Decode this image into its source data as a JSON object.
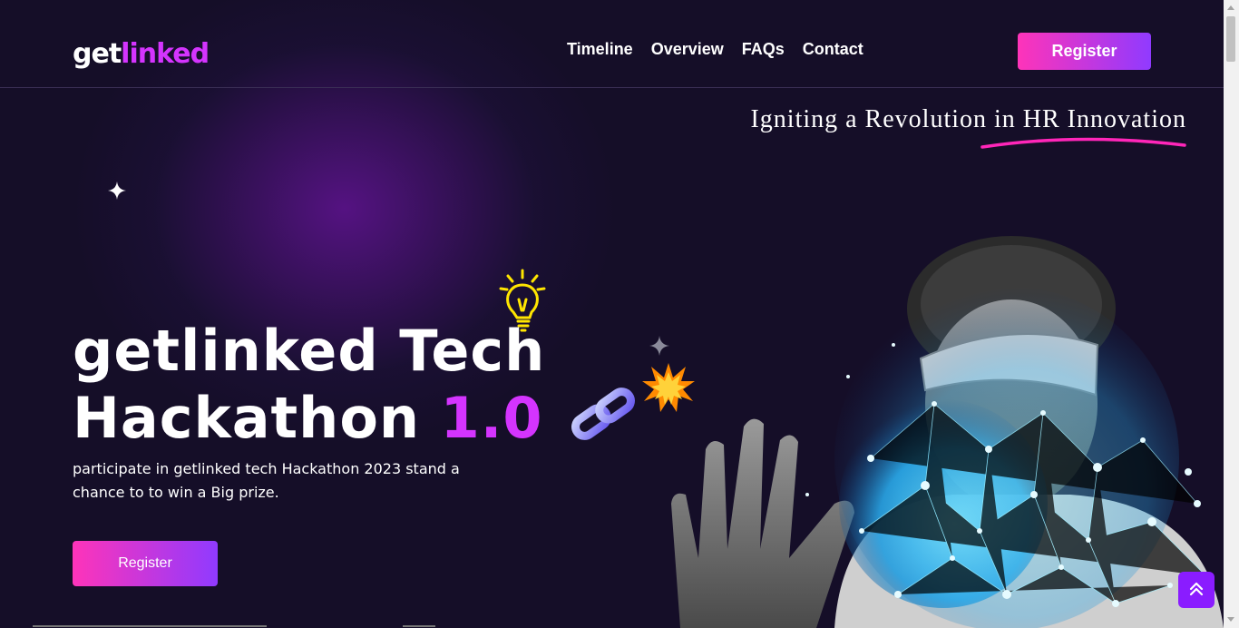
{
  "logo": {
    "part1": "get",
    "part2": "linked"
  },
  "nav": {
    "items": [
      "Timeline",
      "Overview",
      "FAQs",
      "Contact"
    ]
  },
  "header": {
    "register_label": "Register"
  },
  "hero": {
    "tagline": "Igniting a Revolution in HR Innovation",
    "title_line1": "getlinked Tech",
    "title_line2_a": "Hackathon ",
    "title_line2_b": "1.0",
    "description": "participate in getlinked tech Hackathon 2023 stand a chance to to win a Big prize.",
    "register_label": "Register"
  },
  "icons": {
    "scroll_top": "double-chevron-up-icon",
    "bulb": "light-bulb-icon",
    "chain": "chain-link-icon",
    "boom": "explosion-icon",
    "star": "sparkle-star-icon"
  },
  "colors": {
    "background": "#150e28",
    "accent": "#d434fe",
    "gradient_start": "#fe34b9",
    "gradient_end": "#903aff",
    "scroll_button": "#8a1cff"
  }
}
